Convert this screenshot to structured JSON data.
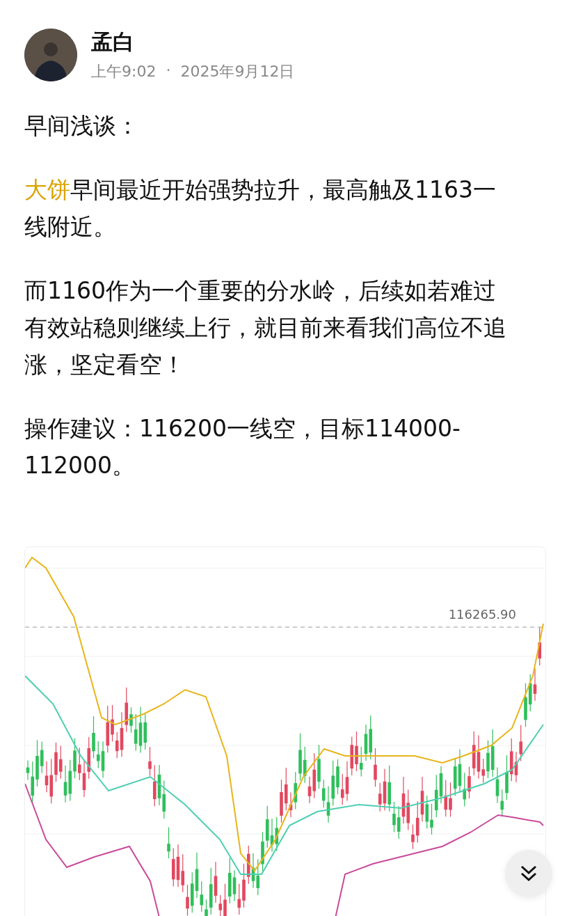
{
  "author": {
    "name": "孟白",
    "time": "上午9:02",
    "separator": "·",
    "date": "2025年9月12日"
  },
  "post": {
    "paragraphs": [
      {
        "segments": [
          {
            "text": "早间浅谈：",
            "highlight": false
          }
        ]
      },
      {
        "segments": [
          {
            "text": "大饼",
            "highlight": true
          },
          {
            "text": "早间最近开始强势拉升，最高触及1163一线附近。",
            "highlight": false
          }
        ]
      },
      {
        "segments": [
          {
            "text": "而1160作为一个重要的分水岭，后续如若难过有效站稳则继续上行，就目前来看我们高位不追涨，坚定看空！",
            "highlight": false
          }
        ]
      },
      {
        "segments": [
          {
            "text": "操作建议：116200一线空，目标114000-112000。",
            "highlight": false
          }
        ]
      }
    ]
  },
  "chart": {
    "kind": "picture",
    "price_label": "116265.90"
  },
  "scroll_button": {
    "kind": "scroll-down"
  }
}
